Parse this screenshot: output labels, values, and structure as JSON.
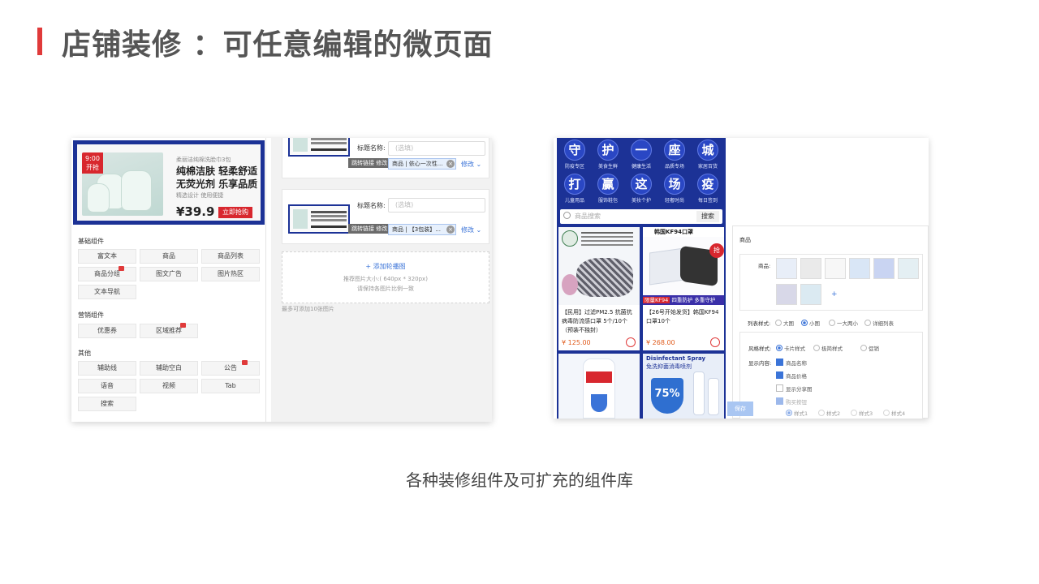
{
  "slide": {
    "title": "店铺装修 ：可任意编辑的微页面",
    "caption": "各种装修组件及可扩充的组件库"
  },
  "left_editor": {
    "banner": {
      "tag_time": "9:00",
      "tag_text": "开抢",
      "subtitle": "柔丽洁纯棉洗脸巾3包",
      "line1": "纯棉洁肤 轻柔舒适",
      "line2": "无荧光剂 乐享品质",
      "note": "精选设计 使用便捷",
      "price": "¥39.9",
      "buy": "立即抢购"
    },
    "groups": [
      {
        "label": "基础组件",
        "items": [
          "富文本",
          "商品",
          "商品列表",
          "商品分组",
          "图文广告",
          "图片热区",
          "文本导航"
        ]
      },
      {
        "label": "营销组件",
        "items": [
          "优惠券",
          "区域推荐"
        ]
      },
      {
        "label": "其他",
        "items": [
          "辅助线",
          "辅助空白",
          "公告",
          "语音",
          "视频",
          "Tab",
          "搜索"
        ]
      }
    ],
    "cards": [
      {
        "title_label": "标题名称:",
        "title_placeholder": "(选填)",
        "jump": "跳转链接",
        "edit_overlay": "修改",
        "link_value": "商品 | 依心一次性...",
        "edit": "修改"
      },
      {
        "title_label": "标题名称:",
        "title_placeholder": "(选填)",
        "jump": "跳转链接",
        "edit_overlay": "修改",
        "link_value": "商品 | 【3包装】...",
        "edit": "修改"
      }
    ],
    "add_image": "添加轮播图",
    "add_hint1": "推荐图片大小:( 640px * 320px)",
    "add_hint2": "请保持各图片比例一致",
    "max_hint": "最多可添加10张图片"
  },
  "right_editor": {
    "nav": [
      {
        "char": "守",
        "caption": "防疫专区"
      },
      {
        "char": "护",
        "caption": "美食生鲜"
      },
      {
        "char": "一",
        "caption": "健康生活"
      },
      {
        "char": "座",
        "caption": "品质专场"
      },
      {
        "char": "城",
        "caption": "家居百货"
      },
      {
        "char": "打",
        "caption": "儿童用品"
      },
      {
        "char": "赢",
        "caption": "服饰鞋包"
      },
      {
        "char": "这",
        "caption": "美妆个护"
      },
      {
        "char": "场",
        "caption": "轻奢时尚"
      },
      {
        "char": "疫",
        "caption": "每日签到"
      }
    ],
    "search_placeholder": "商品搜索",
    "search_button": "搜索",
    "products": [
      {
        "name": "【民用】过滤PM2.5 抗菌抗病毒防流感口罩 5个/10个（预装不独封）",
        "price": "¥ 125.00",
        "badge": ""
      },
      {
        "name": "【26号开始发货】韩国KF94口罩10个",
        "price": "¥ 268.00",
        "badge": "韩国KF94口罩"
      },
      {
        "name": "",
        "price": "",
        "badge": ""
      },
      {
        "name": "",
        "price": "",
        "badge": "Disinfectant Spray"
      }
    ],
    "product_extra": {
      "ribbon": "四重防护 多重守护",
      "ribbon_tag": "限量KF94",
      "spray_sub": "免洗抑菌消毒喷剂",
      "spray_pct": "75%"
    },
    "panel": {
      "header": "商品",
      "goods_label": "商品:",
      "add": "+",
      "list_style_label": "列表样式:",
      "list_styles": [
        "大图",
        "小图",
        "一大两小",
        "详细列表"
      ],
      "list_style_selected": "小图",
      "card_style_label": "风格样式:",
      "card_styles": [
        "卡片样式",
        "极简样式",
        "促销"
      ],
      "card_style_selected": "卡片样式",
      "display_label": "显示内容:",
      "display_items": [
        {
          "label": "商品名称",
          "checked": true
        },
        {
          "label": "商品价格",
          "checked": true
        },
        {
          "label": "显示分享图",
          "checked": false
        },
        {
          "label": "购买按钮",
          "checked": true
        }
      ],
      "button_styles": [
        "样式1",
        "样式2",
        "样式3",
        "样式4"
      ],
      "save": "保存"
    }
  },
  "colors": {
    "accent_red": "#e03a3a",
    "brand_blue": "#1c3296",
    "link_blue": "#3b74d8"
  }
}
